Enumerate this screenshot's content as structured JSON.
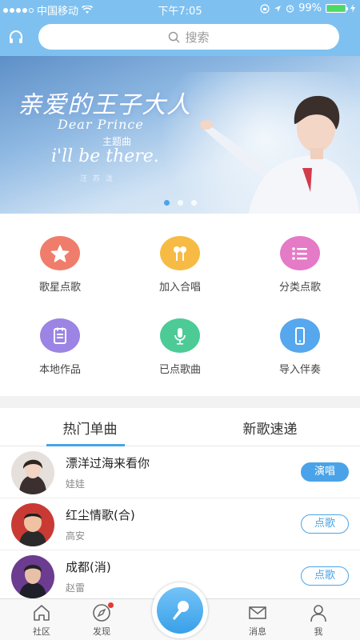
{
  "status_bar": {
    "carrier": "中国移动",
    "time": "下午7:05",
    "battery": "99%",
    "battery_level": 0.99
  },
  "header": {
    "search_placeholder": "搜索",
    "headset_icon": "headphones-icon"
  },
  "banner": {
    "title": "亲爱的王子大人",
    "subtitle": "Dear Prince",
    "theme_label": "主题曲",
    "song": "i'll be there.",
    "artist": "汪 苏 泷",
    "page_count": 3,
    "active_page": 1
  },
  "features": [
    {
      "label": "歌星点歌",
      "icon": "star-icon",
      "color": "#f07d6b"
    },
    {
      "label": "加入合唱",
      "icon": "microphones-icon",
      "color": "#f7bb45"
    },
    {
      "label": "分类点歌",
      "icon": "list-icon",
      "color": "#e57ac7"
    },
    {
      "label": "本地作品",
      "icon": "notepad-icon",
      "color": "#9b84e3"
    },
    {
      "label": "已点歌曲",
      "icon": "microphone-icon",
      "color": "#4ccb97"
    },
    {
      "label": "导入伴奏",
      "icon": "phone-icon",
      "color": "#56a7ee"
    }
  ],
  "tabs": [
    {
      "label": "热门单曲",
      "active": true
    },
    {
      "label": "新歌速递",
      "active": false
    }
  ],
  "songs": [
    {
      "title": "漂洋过海来看你",
      "singer": "娃娃",
      "action": "演唱",
      "filled": true
    },
    {
      "title": "红尘情歌(合)",
      "singer": "高安",
      "action": "点歌",
      "filled": false
    },
    {
      "title": "成都(消)",
      "singer": "赵雷",
      "action": "点歌",
      "filled": false
    }
  ],
  "bottom_nav": [
    {
      "label": "社区",
      "icon": "community-icon"
    },
    {
      "label": "发现",
      "icon": "compass-icon",
      "badge": true
    },
    {
      "label": "",
      "icon": "microphone-icon"
    },
    {
      "label": "消息",
      "icon": "mail-icon"
    },
    {
      "label": "我",
      "icon": "user-icon"
    }
  ],
  "colors": {
    "accent": "#4aa3e8",
    "header_bg": "#7ec1f1"
  }
}
